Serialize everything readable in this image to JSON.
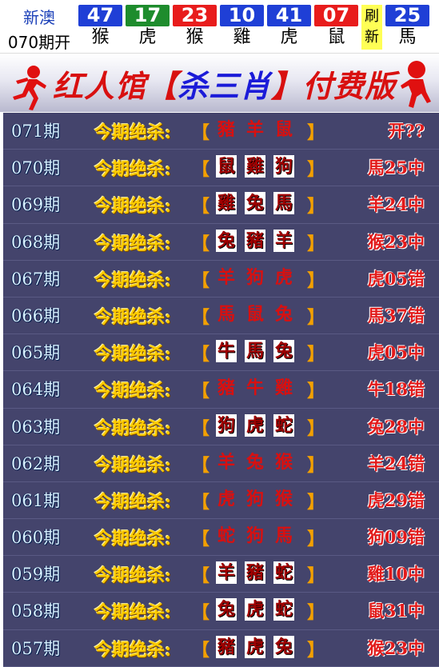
{
  "header": {
    "brand_line1": "新澳",
    "brand_line2": "070期开",
    "balls": [
      {
        "num": "47",
        "zodiac": "猴",
        "color": "blue"
      },
      {
        "num": "17",
        "zodiac": "虎",
        "color": "green"
      },
      {
        "num": "23",
        "zodiac": "猴",
        "color": "red"
      },
      {
        "num": "10",
        "zodiac": "雞",
        "color": "blue"
      },
      {
        "num": "41",
        "zodiac": "虎",
        "color": "blue"
      },
      {
        "num": "07",
        "zodiac": "鼠",
        "color": "red"
      }
    ],
    "refresh_line1": "刷",
    "refresh_line2": "新",
    "special": {
      "num": "25",
      "zodiac": "馬",
      "color": "blue"
    }
  },
  "banner": {
    "title_prefix": "红人馆",
    "bracket_open": "【",
    "title_keyword": "杀三肖",
    "bracket_close": "】",
    "title_suffix": "付费版"
  },
  "table": {
    "label": "今期绝杀:",
    "bracket_open": "【",
    "bracket_close": "】",
    "rows": [
      {
        "period": "071期",
        "z": [
          "豬",
          "羊",
          "鼠"
        ],
        "boxed": false,
        "result": "开??"
      },
      {
        "period": "070期",
        "z": [
          "鼠",
          "雞",
          "狗"
        ],
        "boxed": true,
        "result": "馬25中"
      },
      {
        "period": "069期",
        "z": [
          "雞",
          "兔",
          "馬"
        ],
        "boxed": true,
        "result": "羊24中"
      },
      {
        "period": "068期",
        "z": [
          "兔",
          "豬",
          "羊"
        ],
        "boxed": true,
        "result": "猴23中"
      },
      {
        "period": "067期",
        "z": [
          "羊",
          "狗",
          "虎"
        ],
        "boxed": false,
        "result": "虎05错"
      },
      {
        "period": "066期",
        "z": [
          "馬",
          "鼠",
          "兔"
        ],
        "boxed": false,
        "result": "馬37错"
      },
      {
        "period": "065期",
        "z": [
          "牛",
          "馬",
          "兔"
        ],
        "boxed": true,
        "result": "虎05中"
      },
      {
        "period": "064期",
        "z": [
          "豬",
          "牛",
          "雞"
        ],
        "boxed": false,
        "result": "牛18错"
      },
      {
        "period": "063期",
        "z": [
          "狗",
          "虎",
          "蛇"
        ],
        "boxed": true,
        "result": "兔28中"
      },
      {
        "period": "062期",
        "z": [
          "羊",
          "兔",
          "猴"
        ],
        "boxed": false,
        "result": "羊24错"
      },
      {
        "period": "061期",
        "z": [
          "虎",
          "狗",
          "猴"
        ],
        "boxed": false,
        "result": "虎29错"
      },
      {
        "period": "060期",
        "z": [
          "蛇",
          "狗",
          "馬"
        ],
        "boxed": false,
        "result": "狗09错"
      },
      {
        "period": "059期",
        "z": [
          "羊",
          "豬",
          "蛇"
        ],
        "boxed": true,
        "result": "雞10中"
      },
      {
        "period": "058期",
        "z": [
          "兔",
          "虎",
          "蛇"
        ],
        "boxed": true,
        "result": "鼠31中"
      },
      {
        "period": "057期",
        "z": [
          "豬",
          "虎",
          "兔"
        ],
        "boxed": true,
        "result": "猴23中"
      }
    ]
  },
  "colors": {
    "table_bg": "#44446c",
    "label": "#ffcc00",
    "result": "#e21a1a",
    "ball_red": "#e81c1c",
    "ball_green": "#1e8c2d",
    "ball_blue": "#1f3fd6"
  }
}
